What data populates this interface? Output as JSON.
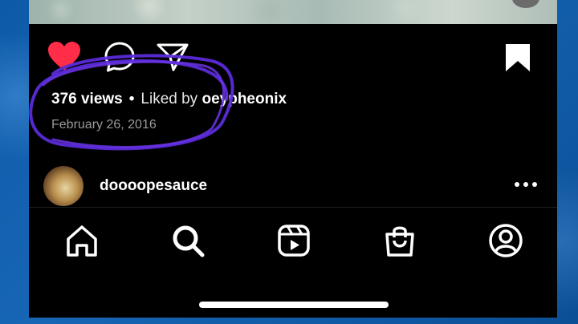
{
  "post": {
    "views_count": "376 views",
    "separator": "•",
    "liked_by_prefix": "Liked by",
    "liked_by_user": "oeypheonix",
    "date": "February 26, 2016"
  },
  "comment": {
    "username": "doooopesauce"
  },
  "colors": {
    "heart": "#ff2d47",
    "scribble": "#5a2bd8",
    "background": "#000000"
  },
  "icons": {
    "like": "heart-icon",
    "comment": "comment-icon",
    "share": "share-icon",
    "save": "bookmark-icon",
    "more": "more-icon",
    "nav": [
      "home-icon",
      "search-icon",
      "reels-icon",
      "shop-icon",
      "profile-icon"
    ]
  }
}
